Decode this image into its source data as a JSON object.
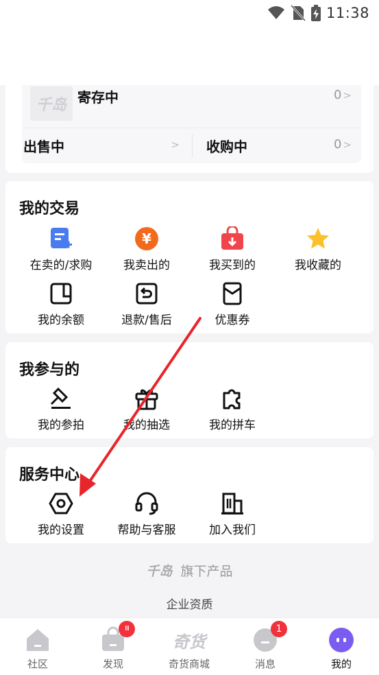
{
  "status_bar": {
    "time": "11:38"
  },
  "assets": {
    "storage_label": "寄存中",
    "storage_count": "0",
    "selling_label": "出售中",
    "buying_label": "收购中",
    "buying_count": "0",
    "brand_watermark": "千岛"
  },
  "trade": {
    "title": "我的交易",
    "items": [
      {
        "label": "在卖的/求购",
        "icon": "post-plus-icon"
      },
      {
        "label": "我卖出的",
        "icon": "yuan-coin-icon"
      },
      {
        "label": "我买到的",
        "icon": "shopping-bag-icon"
      },
      {
        "label": "我收藏的",
        "icon": "star-icon"
      },
      {
        "label": "我的余额",
        "icon": "wallet-icon"
      },
      {
        "label": "退款/售后",
        "icon": "return-icon"
      },
      {
        "label": "优惠券",
        "icon": "coupon-icon"
      }
    ]
  },
  "participate": {
    "title": "我参与的",
    "items": [
      {
        "label": "我的参拍",
        "icon": "gavel-icon"
      },
      {
        "label": "我的抽选",
        "icon": "gift-icon"
      },
      {
        "label": "我的拼车",
        "icon": "puzzle-icon"
      }
    ]
  },
  "service": {
    "title": "服务中心",
    "items": [
      {
        "label": "我的设置",
        "icon": "settings-hex-icon"
      },
      {
        "label": "帮助与客服",
        "icon": "headset-icon"
      },
      {
        "label": "加入我们",
        "icon": "building-icon"
      }
    ]
  },
  "footer": {
    "brand": "千岛",
    "brand_suffix": "旗下产品",
    "qualification": "企业资质"
  },
  "tabbar": {
    "tabs": [
      {
        "label": "社区"
      },
      {
        "label": "发现",
        "badge": "III"
      },
      {
        "label": "奇货商城",
        "logo": "奇货"
      },
      {
        "label": "消息",
        "badge": "1"
      },
      {
        "label": "我的"
      }
    ]
  },
  "colors": {
    "accent_blue": "#4a7cf0",
    "accent_orange": "#f26a1b",
    "accent_red": "#f0454b",
    "star_yellow": "#fbc12d",
    "badge_red": "#f0323c",
    "annotation_red": "#e8252b",
    "avatar_purple": "#7b5cf0"
  }
}
